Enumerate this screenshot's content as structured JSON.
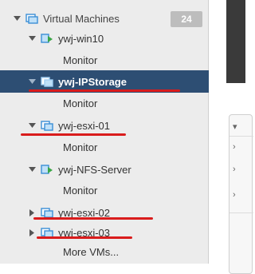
{
  "tree": {
    "header": {
      "label": "Virtual Machines",
      "count": "24"
    },
    "items": [
      {
        "name": "ywj-win10",
        "expanded": true,
        "child": "Monitor",
        "selected": false,
        "icon": "vm-powered-on-icon"
      },
      {
        "name": "ywj-IPStorage",
        "expanded": true,
        "child": "Monitor",
        "selected": true,
        "icon": "vm-icon"
      },
      {
        "name": "ywj-esxi-01",
        "expanded": true,
        "child": "Monitor",
        "selected": false,
        "icon": "vm-icon"
      },
      {
        "name": "ywj-NFS-Server",
        "expanded": true,
        "child": "Monitor",
        "selected": false,
        "icon": "vm-powered-on-icon"
      },
      {
        "name": "ywj-esxi-02",
        "expanded": false,
        "selected": false,
        "icon": "vm-icon"
      },
      {
        "name": "ywj-esxi-03",
        "expanded": false,
        "selected": false,
        "icon": "vm-icon"
      }
    ],
    "more_label": "More VMs..."
  },
  "colors": {
    "selected_bg": "#2d4e73",
    "annotation": "#d91c1c",
    "badge_bg": "#bdbdbd",
    "vm_icon_blue": "#3b8fd6",
    "powered_on_green": "#3aa646"
  }
}
